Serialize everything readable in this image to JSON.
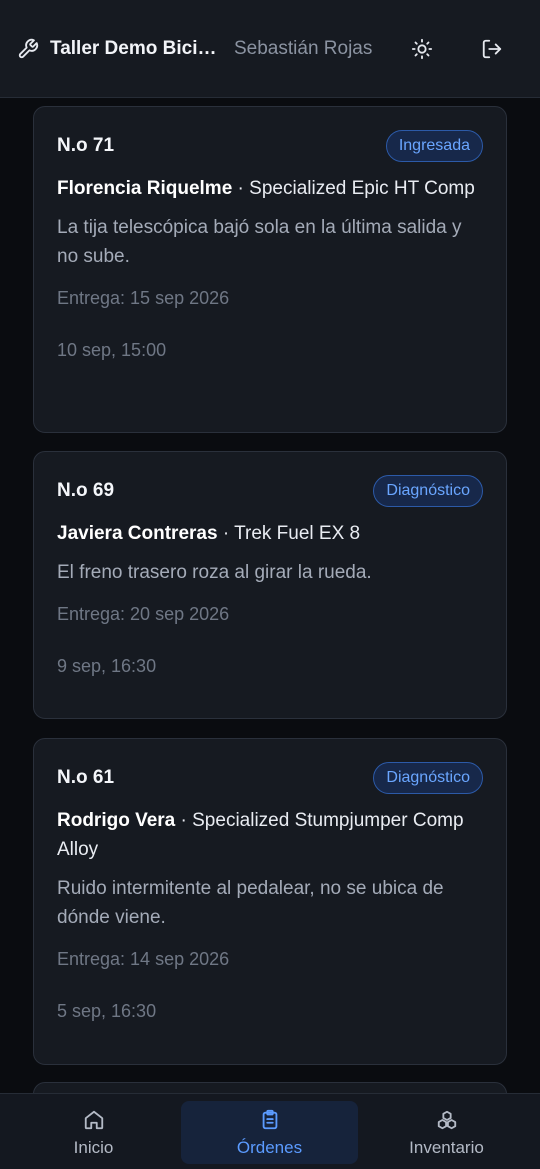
{
  "header": {
    "title": "Taller Demo Bicicletas",
    "user": "Sebastián Rojas",
    "icons": [
      "wrench-icon",
      "sun-icon",
      "logout-icon"
    ]
  },
  "orders": [
    {
      "number": "N.o 71",
      "status": "Ingresada",
      "client": "Florencia Riquelme",
      "bike": " · Specialized Epic HT Comp",
      "issue": "La tija telescópica bajó sola en la última salida y no sube.",
      "due": "Entrega: 15 sep 2026",
      "created": "10 sep, 15:00"
    },
    {
      "number": "N.o 69",
      "status": "Diagnóstico",
      "client": "Javiera Contreras",
      "bike": " · Trek Fuel EX 8",
      "issue": "El freno trasero roza al girar la rueda.",
      "due": "Entrega: 20 sep 2026",
      "created": "9 sep, 16:30"
    },
    {
      "number": "N.o 61",
      "status": "Diagnóstico",
      "client": "Rodrigo Vera",
      "bike": " · Specialized Stumpjumper Comp Alloy",
      "issue": "Ruido intermitente al pedalear, no se ubica de dónde viene.",
      "due": "Entrega: 14 sep 2026",
      "created": "5 sep, 16:30"
    }
  ],
  "nav": {
    "home": "Inicio",
    "orders": "Órdenes",
    "inventory": "Inventario",
    "active": "orders"
  },
  "colors": {
    "accent": "#5b9bff",
    "background": "#0a0c10",
    "card": "#161a21"
  }
}
